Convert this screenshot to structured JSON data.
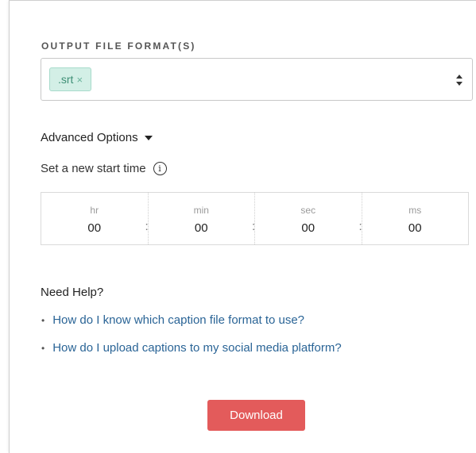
{
  "output": {
    "section_label": "OUTPUT FILE FORMAT(S)",
    "selected_tags": [
      ".srt"
    ],
    "remove_glyph": "×"
  },
  "advanced": {
    "label": "Advanced Options",
    "start_time_label": "Set a new start time",
    "info_glyph": "i",
    "fields": [
      {
        "unit": "hr",
        "value": "00"
      },
      {
        "unit": "min",
        "value": "00"
      },
      {
        "unit": "sec",
        "value": "00"
      },
      {
        "unit": "ms",
        "value": "00"
      }
    ],
    "separator": ":"
  },
  "help": {
    "title": "Need Help?",
    "links": [
      "How do I know which caption file format to use?",
      "How do I upload captions to my social media platform?"
    ],
    "bullet": "•"
  },
  "actions": {
    "download_label": "Download"
  },
  "colors": {
    "accent_button": "#e35b5b",
    "tag_bg": "#d3efe6",
    "tag_text": "#3f8f76",
    "link": "#2a6496"
  }
}
